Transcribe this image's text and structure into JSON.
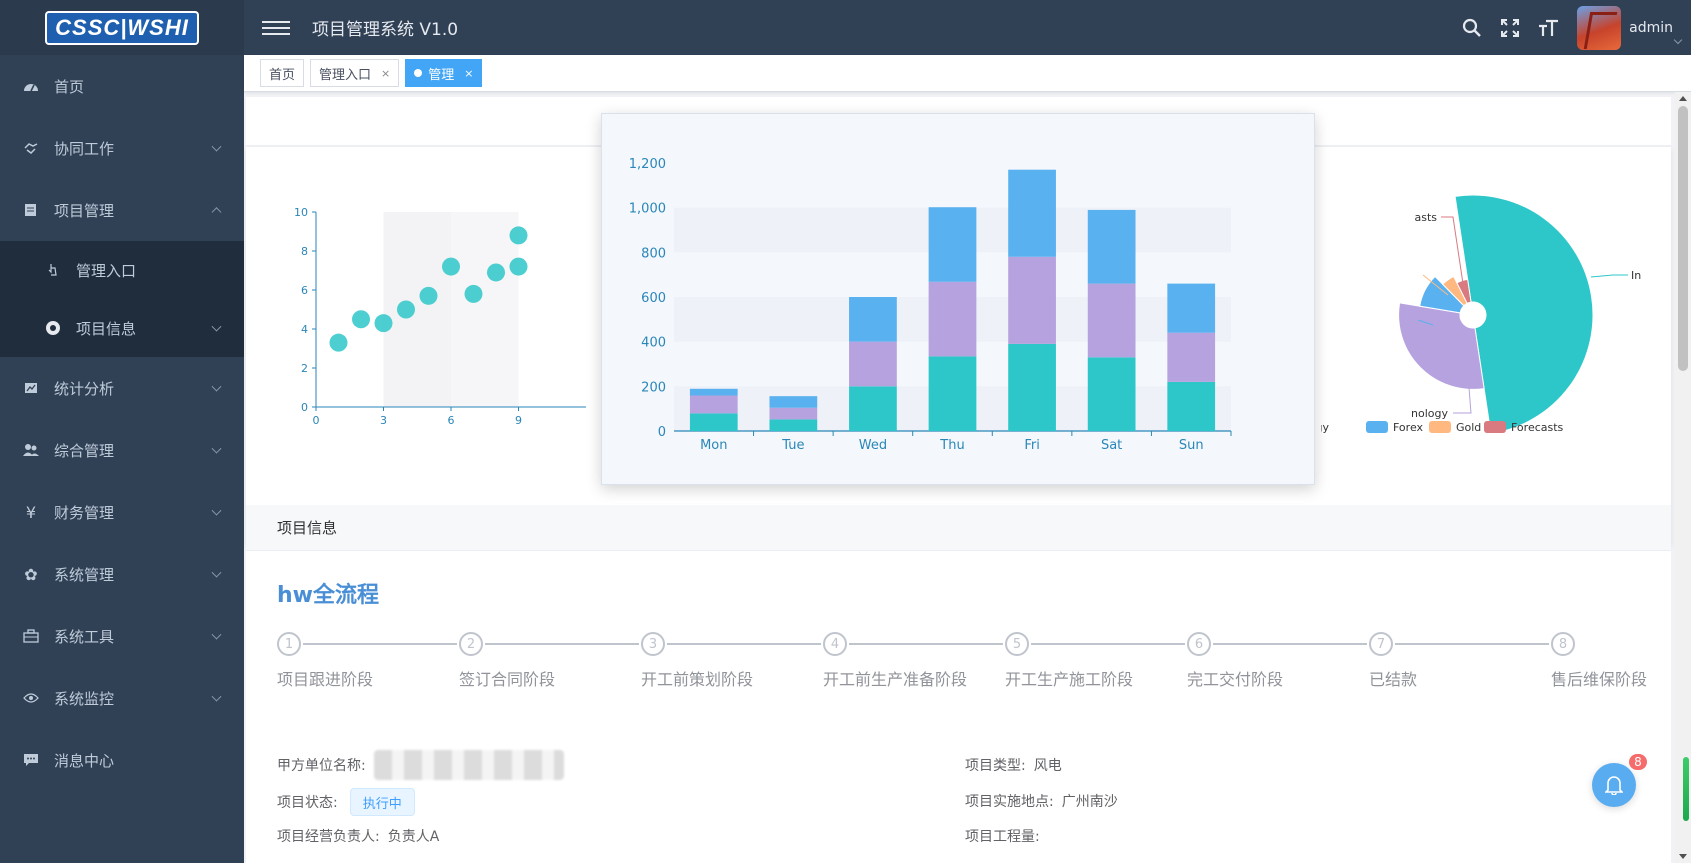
{
  "app": {
    "logo_text": "CSSC|WSHI",
    "title": "项目管理系统 V1.0",
    "username": "admin"
  },
  "sidebar": {
    "items": [
      {
        "label": "首页",
        "icon": "dashboard-icon"
      },
      {
        "label": "协同工作",
        "icon": "handshake-icon"
      },
      {
        "label": "项目管理",
        "icon": "document-icon",
        "expanded": true,
        "children": [
          {
            "label": "管理入口",
            "icon": "pointer-icon"
          },
          {
            "label": "项目信息",
            "icon": "chrome-icon"
          }
        ]
      },
      {
        "label": "统计分析",
        "icon": "chart-icon"
      },
      {
        "label": "综合管理",
        "icon": "users-icon"
      },
      {
        "label": "财务管理",
        "icon": "yen-icon"
      },
      {
        "label": "系统管理",
        "icon": "gear-icon"
      },
      {
        "label": "系统工具",
        "icon": "toolbox-icon"
      },
      {
        "label": "系统监控",
        "icon": "eye-icon"
      },
      {
        "label": "消息中心",
        "icon": "message-icon"
      }
    ]
  },
  "tags": [
    {
      "label": "首页",
      "closable": false,
      "active": false
    },
    {
      "label": "管理入口",
      "closable": true,
      "active": false
    },
    {
      "label": "管理",
      "closable": true,
      "active": true
    }
  ],
  "tag_close": "×",
  "colors": {
    "sidebar_bg": "#304156",
    "accent": "#42a5f5",
    "teal": "#2ec7c9",
    "purple": "#b6a2de",
    "blue": "#5ab1ef",
    "orange": "#ffb980",
    "red": "#d87a80"
  },
  "chart_data": [
    {
      "type": "scatter",
      "x": [
        1,
        2,
        3,
        4,
        5,
        6,
        7,
        8,
        9,
        9
      ],
      "y": [
        3.3,
        4.5,
        4.3,
        5,
        5.7,
        7.2,
        5.8,
        6.9,
        7.2,
        8.8
      ],
      "xticks": [
        "0",
        "3",
        "6",
        "9"
      ],
      "yticks": [
        "0",
        "2",
        "4",
        "6",
        "8",
        "10"
      ],
      "ylim": [
        0,
        10
      ]
    },
    {
      "type": "bar",
      "stacked": true,
      "categories": [
        "Mon",
        "Tue",
        "Wed",
        "Thu",
        "Fri",
        "Sat",
        "Sun"
      ],
      "series": [
        {
          "values": [
            79,
            52,
            200,
            334,
            390,
            330,
            220
          ]
        },
        {
          "values": [
            80,
            52,
            200,
            334,
            390,
            330,
            220
          ]
        },
        {
          "values": [
            30,
            52,
            200,
            334,
            390,
            330,
            220
          ]
        }
      ],
      "yticks": [
        "0",
        "200",
        "400",
        "600",
        "800",
        "1,000",
        "1,200"
      ],
      "ylim": [
        0,
        1200
      ]
    },
    {
      "type": "pie",
      "rose": true,
      "slices": [
        {
          "name": "Industries",
          "value": 50,
          "radius": 1.0
        },
        {
          "name": "Technology",
          "value": 30,
          "radius": 0.62
        },
        {
          "name": "Forex",
          "value": 10,
          "radius": 0.45
        },
        {
          "name": "Gold",
          "value": 5,
          "radius": 0.36
        },
        {
          "name": "Forecasts",
          "value": 5,
          "radius": 0.3
        }
      ],
      "labels_visible": [
        "Industries",
        "nology",
        "asts"
      ],
      "legend": [
        "hnology",
        "Forex",
        "Gold",
        "Forecasts"
      ]
    }
  ],
  "project": {
    "section_title": "项目信息",
    "flow_title": "hw全流程",
    "steps": [
      {
        "num": "1",
        "label": "项目跟进阶段"
      },
      {
        "num": "2",
        "label": "签订合同阶段"
      },
      {
        "num": "3",
        "label": "开工前策划阶段"
      },
      {
        "num": "4",
        "label": "开工前生产准备阶段"
      },
      {
        "num": "5",
        "label": "开工生产施工阶段"
      },
      {
        "num": "6",
        "label": "完工交付阶段"
      },
      {
        "num": "7",
        "label": "已结款"
      },
      {
        "num": "8",
        "label": "售后维保阶段"
      }
    ],
    "fields": {
      "client_label": "甲方单位名称:",
      "type_label": "项目类型:",
      "type_value": "风电",
      "status_label": "项目状态:",
      "status_value": "执行中",
      "location_label": "项目实施地点:",
      "location_value": "广州南沙",
      "manager_label": "项目经营负责人:",
      "manager_value": "负责人A",
      "quantity_label": "项目工程量:"
    }
  },
  "notifications": {
    "count": "8"
  }
}
